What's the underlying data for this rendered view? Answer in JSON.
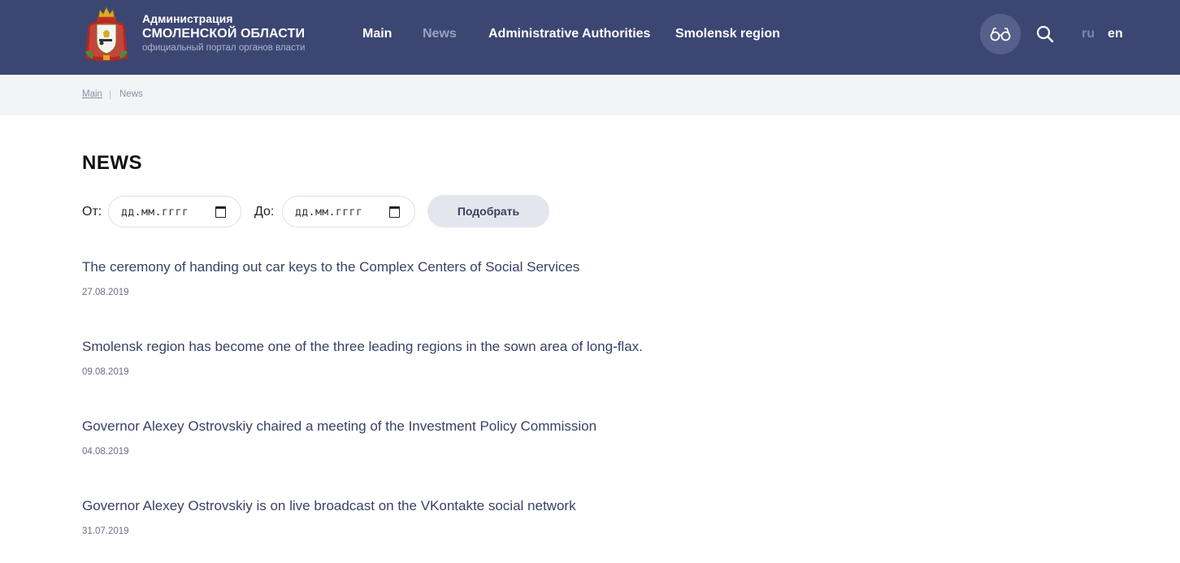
{
  "header": {
    "brand_line1": "Администрация",
    "brand_line2": "СМОЛЕНСКОЙ ОБЛАСТИ",
    "brand_line3": "официальный портал органов власти",
    "nav": [
      {
        "label": "Main",
        "active": false
      },
      {
        "label": "News",
        "active": true
      },
      {
        "label": "Administrative Authorities",
        "active": false
      },
      {
        "label": "Smolensk region",
        "active": false
      }
    ],
    "icons": {
      "accessibility": "glasses-icon",
      "search": "search-icon"
    },
    "lang_ru": "ru",
    "lang_en": "en",
    "colors": {
      "header_bg": "#3c4673",
      "accent_circle": "#56608a"
    }
  },
  "breadcrumb": {
    "home": "Main",
    "separator": "|",
    "current": "News"
  },
  "page": {
    "title": "NEWS"
  },
  "filter": {
    "from_label": "От:",
    "from_placeholder": "дд.мм.гггг",
    "to_label": "До:",
    "to_placeholder": "дд.мм.гггг",
    "submit_label": "Подобрать"
  },
  "news": [
    {
      "title": "The ceremony of handing out car keys to the Complex Centers of Social Services",
      "date": "27.08.2019"
    },
    {
      "title": "Smolensk region has become one of the three leading regions in the sown area of long-flax.",
      "date": "09.08.2019"
    },
    {
      "title": "Governor Alexey Ostrovskiy chaired a meeting of the Investment Policy Commission",
      "date": "04.08.2019"
    },
    {
      "title": "Governor Alexey Ostrovskiy is on live broadcast on the VKontakte social network",
      "date": "31.07.2019"
    }
  ]
}
